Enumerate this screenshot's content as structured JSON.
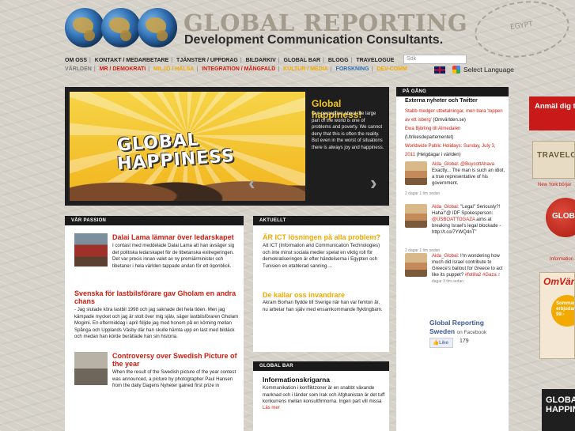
{
  "header": {
    "title": "GLOBAL REPORTING",
    "subtitle": "Development Communication Consultants.",
    "stamp_text": "EGYPT"
  },
  "nav_top": [
    "OM OSS",
    "KONTAKT / MEDARBETARE",
    "TJÄNSTER / UPPDRAG",
    "BILDARKIV",
    "GLOBAL BAR",
    "BLOGG",
    "TRAVELOGUE"
  ],
  "nav_bottom": [
    {
      "label": "VÄRLDEN",
      "color": "#7a7a7a"
    },
    {
      "label": "MR / DEMOKRATI",
      "color": "#d11b0f"
    },
    {
      "label": "MILJÖ / HÄLSA",
      "color": "#f2a900"
    },
    {
      "label": "INTEGRATION / MÅNGFALD",
      "color": "#d11b0f"
    },
    {
      "label": "KULTUR / MEDIA",
      "color": "#f2a900"
    },
    {
      "label": "FORSKNING",
      "color": "#2a6fb5"
    },
    {
      "label": "DEV-COMM",
      "color": "#f2a900"
    }
  ],
  "search": {
    "placeholder": "Sök"
  },
  "language": {
    "label": "Select Language"
  },
  "hero": {
    "image_text_1": "GLOBAL",
    "image_text_2": "HAPPINESS",
    "title": "Global happiness!",
    "text": "Our perception about the large part of the world is one of problems and poverty. We cannot deny that this is often the reality. But even in the worst of situations there is always joy and happiness."
  },
  "var_passion": {
    "heading": "VÅR PASSION",
    "stories": [
      {
        "title": "Dalai Lama lämnar över ledarskapet",
        "text": "I contast med meddelade Dalai Lama att han avsäger sig det politiska ledarskapet för de tibetanska exilregeringen. Det var precis innan valet av ny premiärminister och tibetaner i hela världen tappade andan för ett ögonblick."
      },
      {
        "title": "Svenska för lastbilsförare gav Gholam en andra chans",
        "text": "- Jag slutade köra lastbil 1998 och jag saknade det hela tiden. Men jag kämpade mycket och jag är stolt över mig själv, säger lastbilsföraren Gholam Mogimi. En eftermiddag i april följde jag med honom på en körning mellan Spånga och Upplands Väsby där han skulle hämta upp en last med bildäck och medan han körde berättade han sin historia."
      },
      {
        "title": "Controversy over Swedish Picture of the year",
        "text": "When the result of the Swedish picture of the year contest was announced, a picture by photographer Paul Hansen from the daily Dagens Nyheter gained first prize in international reportage. The picture was of a killed 15 year old girl, Fabienne, who survived the earthquake but was shot by the police."
      }
    ]
  },
  "aktuellt": {
    "heading": "AKTUELLT",
    "items": [
      {
        "title": "ÄR ICT lösningen på alla problem?",
        "text": "Att ICT (Information and Communication Technologies) och inte minst sociala medier spelat en viktig roll för demokratiseringen är efter händelserna i Egypten och Tunisien en etablerad sanning...."
      },
      {
        "title": "De kallar oss invandrare",
        "text": "Akram Borhan flydde till Sverige när han var femton år, nu arbetar han själv med ensamkommande flyktingbarn."
      }
    ]
  },
  "global_bar": {
    "heading": "GLOBAL BAR",
    "title": "Informationskrigarna",
    "text": "Kommunikation i konfliktzoner är en snabbt växande marknad och i länder som Irak och Afghanistan är det tuff konkurrens mellan konsultfirmorna. Ingen part vill missa chansen att påverka...",
    "read_more": "Läs mer"
  },
  "pa_gang": {
    "heading": "PÅ GÅNG",
    "title": "Externa nyheter och Twitter",
    "links": [
      {
        "text": "Stabb medger utbetalningar, men bara 'toppen av ett isberg'",
        "suffix": " (Omvärlden.se)"
      },
      {
        "text": "Ewa Björling till Almedalen",
        "suffix": " (Utrikesdepartementet)"
      },
      {
        "text": "Worldwide Public Holidays: Sunday, July 3, 2011",
        "suffix": " (Helgdagar i världen)"
      }
    ],
    "tweets": [
      {
        "user": "Aida_Global:",
        "mention": "@BoycottAhava",
        "text": " Exactly... The man is such an idiot, a true representative of his government.",
        "time": "2 dagar 1 tim sedan"
      },
      {
        "user": "Aida_Global:",
        "mention": "",
        "text": " \"Legal\" Seriously?! Haha!\"@ IDF Spokesperson: ",
        "mention2": "@USBOATTOGAZA",
        "text2": " aims at breaking Israel's legal blockade - http://t.co/7YWQ4nT\"",
        "time": "2 dagar 1 tim sedan"
      },
      {
        "user": "Aida_Global:",
        "mention": "",
        "text": " I'm wondering how much did Israel contribute to Greece's bailout for Greece to act like its puppet? ",
        "mention2": "#fotilla2 #Gaza",
        "text2": "",
        "time": "2 dagar 3 tim sedan"
      }
    ],
    "facebook": {
      "title": "Global Reporting Sweden",
      "on": "on Facebook",
      "like": "Like",
      "count": "179"
    }
  },
  "ads": {
    "red_banner": "Anmäl dig till nyhetsbrevet",
    "travel": "TRAVELOGUE",
    "travel_caption": "New York börjar",
    "globe": "GLOBAL",
    "globe_caption": "Information",
    "omv_title": "OmVärlden",
    "omv_badge": "Sommar-erbjudande 99:-",
    "bottom": "GLOBAL HAPPINESS"
  }
}
